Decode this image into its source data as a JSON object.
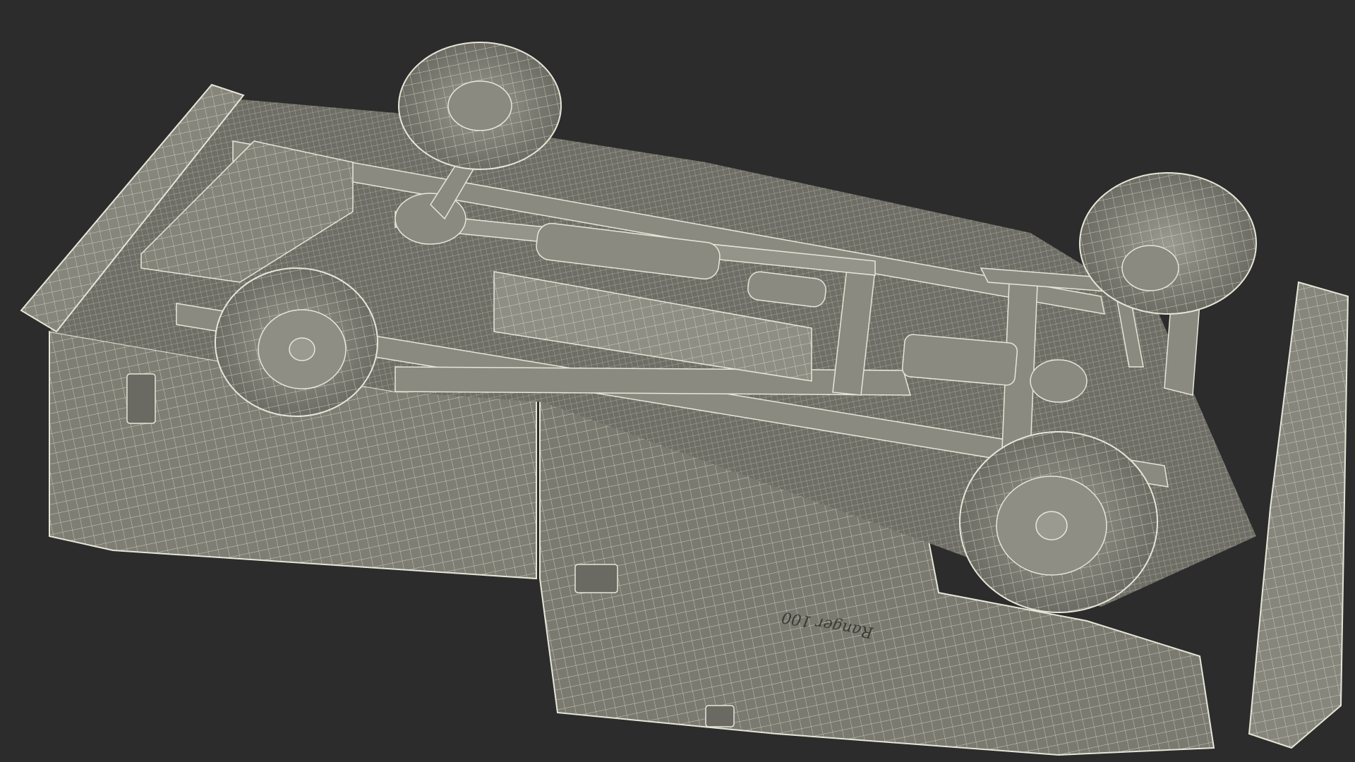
{
  "viewport": {
    "background_color": "#2c2c2c"
  },
  "model": {
    "badge_text": "Ranger 100",
    "body_color": "#7e7e74",
    "wire_color": "#e6e6d8",
    "shadow_color": "#55554d",
    "tire_color": "#8a8a80"
  }
}
